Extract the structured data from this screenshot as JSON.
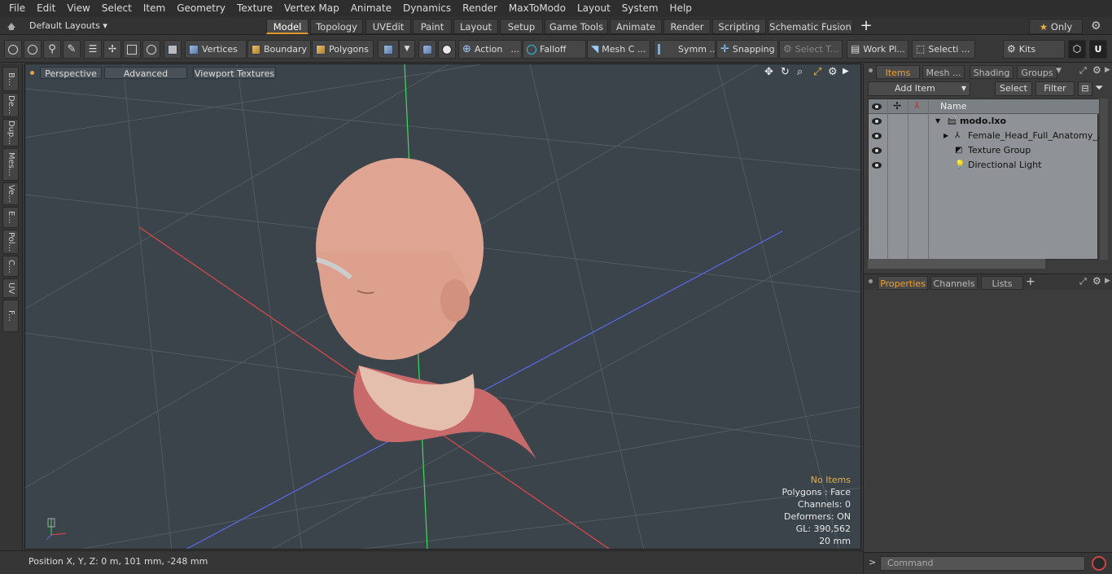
{
  "menu": [
    "File",
    "Edit",
    "View",
    "Select",
    "Item",
    "Geometry",
    "Texture",
    "Vertex Map",
    "Animate",
    "Dynamics",
    "Render",
    "MaxToModo",
    "Layout",
    "System",
    "Help"
  ],
  "layout_selector": "Default Layouts",
  "mode_tabs": [
    "Model",
    "Topology",
    "UVEdit",
    "Paint",
    "Layout",
    "Setup",
    "Game Tools",
    "Animate",
    "Render",
    "Scripting",
    "Schematic Fusion"
  ],
  "active_tab": "Model",
  "only_label": "Only",
  "toolbar": {
    "vertices": "Vertices",
    "boundary": "Boundary",
    "polygons": "Polygons",
    "action": "Action",
    "falloff": "Falloff",
    "mesh": "Mesh C ...",
    "symm": "Symm ...",
    "snapping": "Snapping",
    "select_t": "Select T...",
    "work_pl": "Work Pl...",
    "selecti": "Selecti ...",
    "kits": "Kits"
  },
  "left_tabs": [
    "B...",
    "De...",
    "Dup...",
    "Mes...",
    "Ve...",
    "E...",
    "Pol...",
    "C...",
    "UV",
    "F..."
  ],
  "viewport": {
    "perspective": "Perspective",
    "advanced": "Advanced",
    "viewport_textures": "Viewport Textures",
    "stats": {
      "no_items": "No Items",
      "polygons": "Polygons : Face",
      "channels": "Channels: 0",
      "deformers": "Deformers: ON",
      "gl": "GL: 390,562",
      "scale": "20 mm"
    },
    "colors": {
      "no_items": "#e8b040",
      "background": "#3b434b"
    }
  },
  "status": {
    "position": "Position X, Y, Z:   0 m, 101 mm, -248 mm"
  },
  "right_panel": {
    "tabs": [
      "Items",
      "Mesh ...",
      "Shading",
      "Groups"
    ],
    "active_tab": "Items",
    "add_item": "Add Item",
    "select": "Select",
    "filter": "Filter",
    "column_name": "Name",
    "items": [
      {
        "label": "modo.lxo",
        "bold": true
      },
      {
        "label": "Female_Head_Full_Anatomy_..."
      },
      {
        "label": "Texture Group"
      },
      {
        "label": "Directional Light"
      }
    ],
    "prop_tabs": [
      "Properties",
      "Channels",
      "Lists"
    ],
    "active_prop_tab": "Properties",
    "command_placeholder": "Command"
  }
}
